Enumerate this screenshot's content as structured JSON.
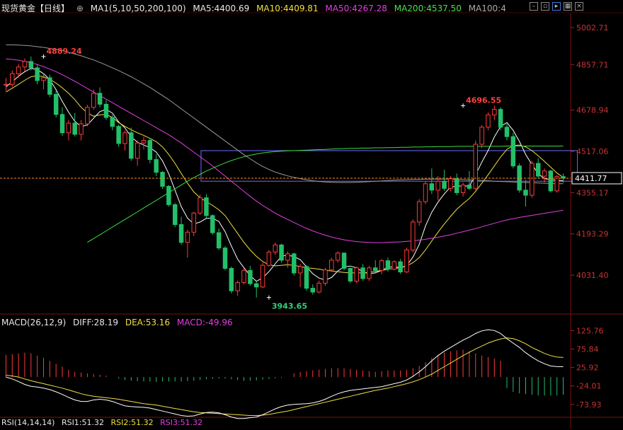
{
  "header": {
    "symbol": "现货黄金【日线】",
    "circle_icon": "⊕",
    "ma_label": "MA1(5,10,50,200,100)",
    "ma5": "MA5:4400.69",
    "ma10": "MA10:4409.81",
    "ma50": "MA50:4267.28",
    "ma200": "MA200:4537.50",
    "ma100": "MA100:4"
  },
  "macd_header": {
    "label": "MACD(26,12,9)",
    "diff": "DIFF:28.19",
    "dea": "DEA:53.16",
    "macd": "MACD:-49.96"
  },
  "rsi_header": {
    "label": "RSI(14,14,14)",
    "rsi1": "RSI1:51.32",
    "rsi2": "RSI2:51.32",
    "rsi3": "RSI3:51.32"
  },
  "toolbar_icons": [
    "minus-icon",
    "window-icon",
    "arrow-icon",
    "grid-icon",
    "close-icon"
  ],
  "colors": {
    "up": "#ff3b3b",
    "down": "#22c06a",
    "ma5": "#ffffff",
    "ma10": "#f0e042",
    "ma50": "#e040e0",
    "ma200": "#3cdc3c",
    "ma100": "#9a9a9a",
    "box": "#6b6bff",
    "current": "#ff8c1a"
  },
  "chart_data": {
    "type": "candlestick",
    "price_axis": {
      "ticks": [
        5002.71,
        4857.71,
        4678.94,
        4517.06,
        4355.17,
        4193.29,
        4031.4
      ],
      "range": [
        3890,
        5050
      ]
    },
    "current_price": 4411.77,
    "annotations": [
      {
        "text": "4889.24",
        "value": 4889.24,
        "bar": 16
      },
      {
        "text": "4696.55",
        "value": 4696.55,
        "bar": 210
      },
      {
        "text": "3943.65",
        "value": 3943.65,
        "bar": 120
      }
    ],
    "box": {
      "start_bar": 90,
      "end_bar": 258,
      "top": 4520,
      "bottom": 4400
    },
    "candles": [
      [
        4778,
        4805,
        4755,
        4780
      ],
      [
        4780,
        4835,
        4770,
        4822
      ],
      [
        4822,
        4860,
        4805,
        4848
      ],
      [
        4848,
        4882,
        4832,
        4870
      ],
      [
        4870,
        4889,
        4835,
        4845
      ],
      [
        4845,
        4860,
        4780,
        4795
      ],
      [
        4795,
        4822,
        4760,
        4806
      ],
      [
        4806,
        4818,
        4730,
        4741
      ],
      [
        4741,
        4755,
        4650,
        4662
      ],
      [
        4662,
        4690,
        4578,
        4590
      ],
      [
        4590,
        4640,
        4560,
        4628
      ],
      [
        4628,
        4668,
        4575,
        4584
      ],
      [
        4584,
        4640,
        4560,
        4625
      ],
      [
        4625,
        4700,
        4615,
        4690
      ],
      [
        4690,
        4760,
        4680,
        4745
      ],
      [
        4745,
        4768,
        4690,
        4702
      ],
      [
        4702,
        4718,
        4640,
        4650
      ],
      [
        4650,
        4660,
        4600,
        4615
      ],
      [
        4615,
        4622,
        4535,
        4548
      ],
      [
        4548,
        4600,
        4520,
        4590
      ],
      [
        4590,
        4610,
        4480,
        4490
      ],
      [
        4490,
        4560,
        4460,
        4550
      ],
      [
        4550,
        4575,
        4525,
        4560
      ],
      [
        4560,
        4570,
        4470,
        4485
      ],
      [
        4485,
        4505,
        4420,
        4435
      ],
      [
        4435,
        4440,
        4370,
        4380
      ],
      [
        4380,
        4385,
        4300,
        4308
      ],
      [
        4308,
        4315,
        4220,
        4230
      ],
      [
        4230,
        4260,
        4150,
        4160
      ],
      [
        4160,
        4210,
        4100,
        4200
      ],
      [
        4200,
        4280,
        4185,
        4275
      ],
      [
        4275,
        4348,
        4268,
        4335
      ],
      [
        4335,
        4350,
        4255,
        4265
      ],
      [
        4265,
        4270,
        4190,
        4198
      ],
      [
        4198,
        4215,
        4130,
        4138
      ],
      [
        4138,
        4145,
        4050,
        4058
      ],
      [
        4058,
        4065,
        3960,
        3970
      ],
      [
        3970,
        4010,
        3950,
        4002
      ],
      [
        4002,
        4060,
        3995,
        4050
      ],
      [
        4050,
        4068,
        3990,
        3998
      ],
      [
        3998,
        4005,
        3943.65,
        3985
      ],
      [
        3985,
        4080,
        3980,
        4070
      ],
      [
        4070,
        4130,
        4065,
        4122
      ],
      [
        4122,
        4160,
        4110,
        4150
      ],
      [
        4150,
        4155,
        4080,
        4090
      ],
      [
        4090,
        4125,
        4060,
        4115
      ],
      [
        4115,
        4120,
        4030,
        4040
      ],
      [
        4040,
        4075,
        3985,
        4065
      ],
      [
        4065,
        4070,
        3970,
        3980
      ],
      [
        3980,
        3995,
        3955,
        3965
      ],
      [
        3965,
        4010,
        3960,
        4000
      ],
      [
        4000,
        4060,
        3990,
        4052
      ],
      [
        4052,
        4100,
        4045,
        4090
      ],
      [
        4090,
        4125,
        4080,
        4118
      ],
      [
        4118,
        4120,
        4050,
        4058
      ],
      [
        4058,
        4062,
        4000,
        4008
      ],
      [
        4008,
        4065,
        4000,
        4060
      ],
      [
        4060,
        4075,
        4010,
        4018
      ],
      [
        4018,
        4068,
        4008,
        4060
      ],
      [
        4060,
        4090,
        4042,
        4050
      ],
      [
        4050,
        4095,
        4035,
        4088
      ],
      [
        4088,
        4100,
        4045,
        4055
      ],
      [
        4055,
        4090,
        4050,
        4084
      ],
      [
        4084,
        4095,
        4036,
        4044
      ],
      [
        4044,
        4140,
        4040,
        4130
      ],
      [
        4130,
        4250,
        4120,
        4240
      ],
      [
        4240,
        4330,
        4225,
        4320
      ],
      [
        4320,
        4400,
        4310,
        4390
      ],
      [
        4390,
        4450,
        4350,
        4365
      ],
      [
        4365,
        4420,
        4325,
        4400
      ],
      [
        4400,
        4445,
        4362,
        4372
      ],
      [
        4372,
        4420,
        4360,
        4410
      ],
      [
        4410,
        4430,
        4345,
        4355
      ],
      [
        4355,
        4395,
        4340,
        4385
      ],
      [
        4385,
        4440,
        4365,
        4372
      ],
      [
        4372,
        4560,
        4365,
        4545
      ],
      [
        4545,
        4620,
        4530,
        4612
      ],
      [
        4612,
        4670,
        4600,
        4660
      ],
      [
        4660,
        4696.55,
        4640,
        4682
      ],
      [
        4682,
        4690,
        4600,
        4612
      ],
      [
        4612,
        4625,
        4560,
        4575
      ],
      [
        4575,
        4590,
        4450,
        4460
      ],
      [
        4460,
        4470,
        4355,
        4365
      ],
      [
        4365,
        4405,
        4300,
        4345
      ],
      [
        4345,
        4480,
        4335,
        4470
      ],
      [
        4470,
        4490,
        4410,
        4420
      ],
      [
        4420,
        4450,
        4395,
        4440
      ],
      [
        4440,
        4445,
        4355,
        4362
      ],
      [
        4362,
        4425,
        4355,
        4418
      ],
      [
        4418,
        4430,
        4395,
        4412
      ]
    ],
    "series_lines": [
      {
        "series": "MA5",
        "values": [
          4770,
          4790,
          4812,
          4830,
          4843,
          4838,
          4822,
          4799,
          4759,
          4713,
          4671,
          4635,
          4614,
          4621,
          4647,
          4673,
          4682,
          4667,
          4633,
          4609,
          4574,
          4553,
          4542,
          4532,
          4514,
          4480,
          4429,
          4365,
          4300,
          4255,
          4232,
          4240,
          4254,
          4255,
          4242,
          4202,
          4146,
          4094,
          4061,
          4030,
          4007,
          4021,
          4045,
          4076,
          4106,
          4110,
          4104,
          4092,
          4064,
          4037,
          4020,
          4012,
          4022,
          4048,
          4064,
          4067,
          4060,
          4044,
          4037,
          4040,
          4050,
          4063,
          4064,
          4061,
          4069,
          4102,
          4152,
          4224,
          4278,
          4318,
          4350,
          4377,
          4380,
          4382,
          4380,
          4425,
          4475,
          4520,
          4574,
          4615,
          4630,
          4600,
          4556,
          4505,
          4465,
          4430,
          4410,
          4407,
          4403,
          4402
        ]
      },
      {
        "series": "MA10",
        "values": [
          4750,
          4765,
          4780,
          4796,
          4810,
          4814,
          4810,
          4800,
          4785,
          4766,
          4745,
          4720,
          4690,
          4668,
          4655,
          4660,
          4662,
          4650,
          4630,
          4615,
          4602,
          4590,
          4580,
          4568,
          4555,
          4535,
          4505,
          4470,
          4430,
          4392,
          4358,
          4335,
          4320,
          4305,
          4288,
          4265,
          4230,
          4195,
          4160,
          4130,
          4105,
          4085,
          4072,
          4068,
          4070,
          4072,
          4070,
          4065,
          4060,
          4058,
          4055,
          4050,
          4048,
          4045,
          4042,
          4040,
          4040,
          4040,
          4042,
          4046,
          4050,
          4054,
          4058,
          4060,
          4068,
          4080,
          4100,
          4130,
          4165,
          4200,
          4232,
          4262,
          4290,
          4312,
          4332,
          4360,
          4392,
          4425,
          4460,
          4495,
          4525,
          4540,
          4542,
          4535,
          4520,
          4500,
          4478,
          4455,
          4432,
          4415
        ]
      },
      {
        "series": "MA50",
        "values": [
          4880,
          4878,
          4875,
          4870,
          4865,
          4858,
          4850,
          4840,
          4830,
          4818,
          4805,
          4792,
          4778,
          4764,
          4750,
          4736,
          4722,
          4708,
          4694,
          4680,
          4666,
          4652,
          4638,
          4624,
          4610,
          4596,
          4582,
          4566,
          4550,
          4532,
          4514,
          4496,
          4478,
          4460,
          4440,
          4420,
          4400,
          4380,
          4360,
          4340,
          4322,
          4305,
          4290,
          4275,
          4262,
          4250,
          4238,
          4226,
          4215,
          4205,
          4196,
          4188,
          4181,
          4175,
          4170,
          4166,
          4163,
          4161,
          4160,
          4159,
          4159,
          4160,
          4161,
          4162,
          4164,
          4166,
          4169,
          4172,
          4176,
          4180,
          4185,
          4190,
          4196,
          4202,
          4208,
          4214,
          4221,
          4228,
          4235,
          4242,
          4248,
          4253,
          4258,
          4262,
          4266,
          4270,
          4274,
          4278,
          4282,
          4286
        ]
      },
      {
        "series": "MA200",
        "start_index": 13,
        "values": [
          4160,
          4175,
          4190,
          4205,
          4220,
          4235,
          4250,
          4265,
          4280,
          4295,
          4310,
          4325,
          4340,
          4355,
          4370,
          4385,
          4400,
          4414,
          4427,
          4440,
          4451,
          4462,
          4472,
          4481,
          4489,
          4496,
          4502,
          4507,
          4511,
          4514,
          4516,
          4518,
          4519,
          4520,
          4521,
          4522,
          4523,
          4524,
          4525,
          4526,
          4527,
          4528,
          4529,
          4529,
          4530,
          4530,
          4531,
          4531,
          4532,
          4532,
          4533,
          4533,
          4534,
          4534,
          4535,
          4535,
          4536,
          4536,
          4536,
          4537,
          4537,
          4537,
          4537,
          4537,
          4537,
          4537,
          4537,
          4538,
          4538,
          4538,
          4538,
          4538,
          4538,
          4538,
          4538,
          4538,
          4538
        ]
      },
      {
        "series": "MA100",
        "values": [
          4935,
          4935,
          4934,
          4933,
          4931,
          4928,
          4925,
          4921,
          4917,
          4912,
          4906,
          4899,
          4892,
          4884,
          4876,
          4866,
          4856,
          4845,
          4834,
          4822,
          4810,
          4796,
          4782,
          4768,
          4752,
          4736,
          4720,
          4702,
          4684,
          4666,
          4648,
          4630,
          4612,
          4594,
          4576,
          4558,
          4540,
          4522,
          4504,
          4488,
          4472,
          4458,
          4446,
          4436,
          4428,
          4421,
          4415,
          4410,
          4406,
          4402,
          4399,
          4397,
          4396,
          4395,
          4395,
          4395,
          4396,
          4397,
          4398,
          4400,
          4401,
          4403,
          4404,
          4405,
          4406,
          4407,
          4407,
          4408,
          4408,
          4408,
          4408,
          4408,
          4407,
          4406,
          4405,
          4404,
          4403,
          4402,
          4400,
          4399,
          4398,
          4397,
          4396,
          4395,
          4394,
          4393,
          4392,
          4391,
          4390,
          4390
        ]
      }
    ],
    "macd_panel": {
      "ticks": [
        125.76,
        75.84,
        25.92,
        -24.01,
        -73.93
      ],
      "range": [
        -105,
        140
      ],
      "diff": [
        0,
        -5,
        -12,
        -20,
        -25,
        -27,
        -30,
        -34,
        -40,
        -47,
        -55,
        -62,
        -66,
        -66,
        -62,
        -60,
        -62,
        -66,
        -72,
        -78,
        -80,
        -81,
        -82,
        -84,
        -88,
        -92,
        -96,
        -100,
        -104,
        -106,
        -105,
        -100,
        -96,
        -95,
        -97,
        -102,
        -108,
        -112,
        -112,
        -110,
        -108,
        -102,
        -94,
        -86,
        -80,
        -76,
        -74,
        -73,
        -72,
        -70,
        -66,
        -60,
        -52,
        -45,
        -40,
        -36,
        -34,
        -32,
        -30,
        -28,
        -26,
        -22,
        -18,
        -14,
        -8,
        2,
        14,
        28,
        44,
        58,
        70,
        80,
        90,
        100,
        108,
        118,
        125,
        128,
        126,
        118,
        104,
        92,
        80,
        66,
        54,
        44,
        36,
        30,
        28.19,
        28
      ],
      "dea": [
        5,
        3,
        0,
        -5,
        -10,
        -14,
        -18,
        -22,
        -26,
        -30,
        -35,
        -40,
        -45,
        -49,
        -52,
        -54,
        -56,
        -58,
        -60,
        -63,
        -66,
        -69,
        -72,
        -74,
        -76,
        -79,
        -82,
        -85,
        -88,
        -91,
        -94,
        -96,
        -97,
        -98,
        -99,
        -100,
        -101,
        -102,
        -103,
        -104,
        -104,
        -103,
        -101,
        -98,
        -95,
        -92,
        -88,
        -84,
        -80,
        -76,
        -72,
        -68,
        -64,
        -60,
        -56,
        -52,
        -48,
        -44,
        -40,
        -36,
        -33,
        -30,
        -26,
        -22,
        -18,
        -13,
        -7,
        0,
        8,
        18,
        28,
        38,
        48,
        58,
        67,
        76,
        84,
        92,
        98,
        103,
        106,
        104,
        98,
        90,
        80,
        72,
        64,
        58,
        54,
        53.16
      ],
      "hist": [
        60,
        62,
        64,
        66,
        64,
        58,
        52,
        44,
        36,
        28,
        20,
        14,
        12,
        10,
        8,
        6,
        4,
        0,
        -4,
        -8,
        -10,
        -11,
        -12,
        -12,
        -13,
        -12,
        -12,
        -12,
        -12,
        -11,
        -10,
        -8,
        -6,
        -5,
        -4,
        -4,
        -6,
        -8,
        -10,
        -10,
        -9,
        -7,
        -5,
        -3,
        -2,
        0,
        10,
        14,
        16,
        18,
        20,
        22,
        24,
        24,
        24,
        22,
        20,
        18,
        16,
        14,
        16,
        18,
        18,
        18,
        20,
        24,
        30,
        40,
        52,
        60,
        66,
        70,
        72,
        74,
        70,
        64,
        58,
        54,
        50,
        44,
        -30,
        -40,
        -44,
        -46,
        -48,
        -50,
        -50,
        -50,
        -49.96,
        -48
      ]
    }
  }
}
